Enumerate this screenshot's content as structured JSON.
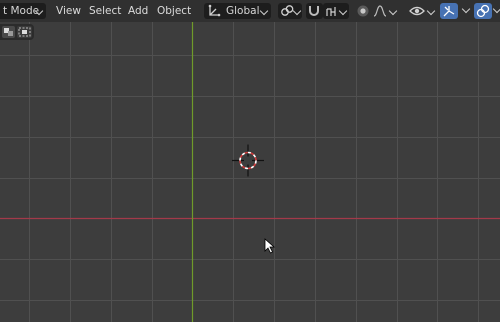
{
  "header": {
    "mode_label": "t Mode",
    "menus": [
      "View",
      "Select",
      "Add",
      "Object"
    ],
    "transform_orientation": "Global"
  },
  "icons": {
    "orientation": "axis-orientation-icon",
    "pivot": "pivot-point-icon",
    "snap": "magnet-snap-icon",
    "snap_target": "snap-increment-icon",
    "proportional": "proportional-editing-icon",
    "falloff": "falloff-curve-icon",
    "visibility": "eye-visibility-icon",
    "gizmo": "gizmo-icon",
    "overlays": "overlays-icon",
    "cursor": "3d-cursor-icon",
    "pointer": "mouse-pointer-icon"
  },
  "colors": {
    "header_bg": "#303030",
    "viewport_bg": "#3d3d3d",
    "x_axis": "#a33a4a",
    "y_axis": "#6f9b2a",
    "accent": "#4772b3"
  }
}
